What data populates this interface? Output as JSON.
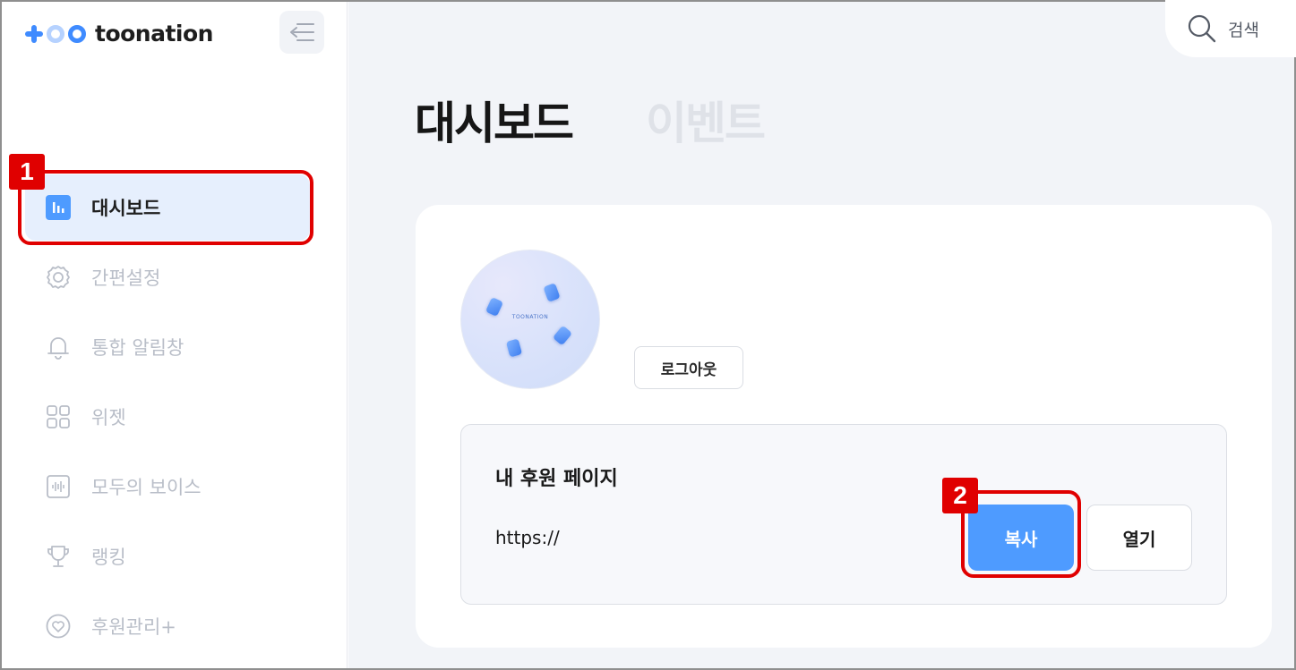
{
  "brand": {
    "name": "toonation"
  },
  "sidebar": {
    "items": [
      {
        "label": "대시보드",
        "icon": "bar-chart-icon",
        "active": true
      },
      {
        "label": "간편설정",
        "icon": "gear-icon",
        "active": false
      },
      {
        "label": "통합 알림창",
        "icon": "bell-icon",
        "active": false
      },
      {
        "label": "위젯",
        "icon": "grid-icon",
        "active": false
      },
      {
        "label": "모두의 보이스",
        "icon": "waveform-icon",
        "active": false
      },
      {
        "label": "랭킹",
        "icon": "trophy-icon",
        "active": false
      },
      {
        "label": "후원관리+",
        "icon": "heart-icon",
        "active": false
      }
    ]
  },
  "header": {
    "search_label": "검색",
    "tabs": [
      {
        "label": "대시보드",
        "active": true
      },
      {
        "label": "이벤트",
        "active": false
      }
    ]
  },
  "profile": {
    "avatar_text": "TOONATION",
    "logout_label": "로그아웃"
  },
  "donation_page": {
    "title": "내 후원 페이지",
    "url": "https://",
    "copy_label": "복사",
    "open_label": "열기"
  },
  "annotations": {
    "badge_1": "1",
    "badge_2": "2"
  },
  "colors": {
    "accent": "#4e9bff",
    "brand_blue": "#3f8bff",
    "active_bg": "#e6effd",
    "callout_red": "#e00000"
  }
}
